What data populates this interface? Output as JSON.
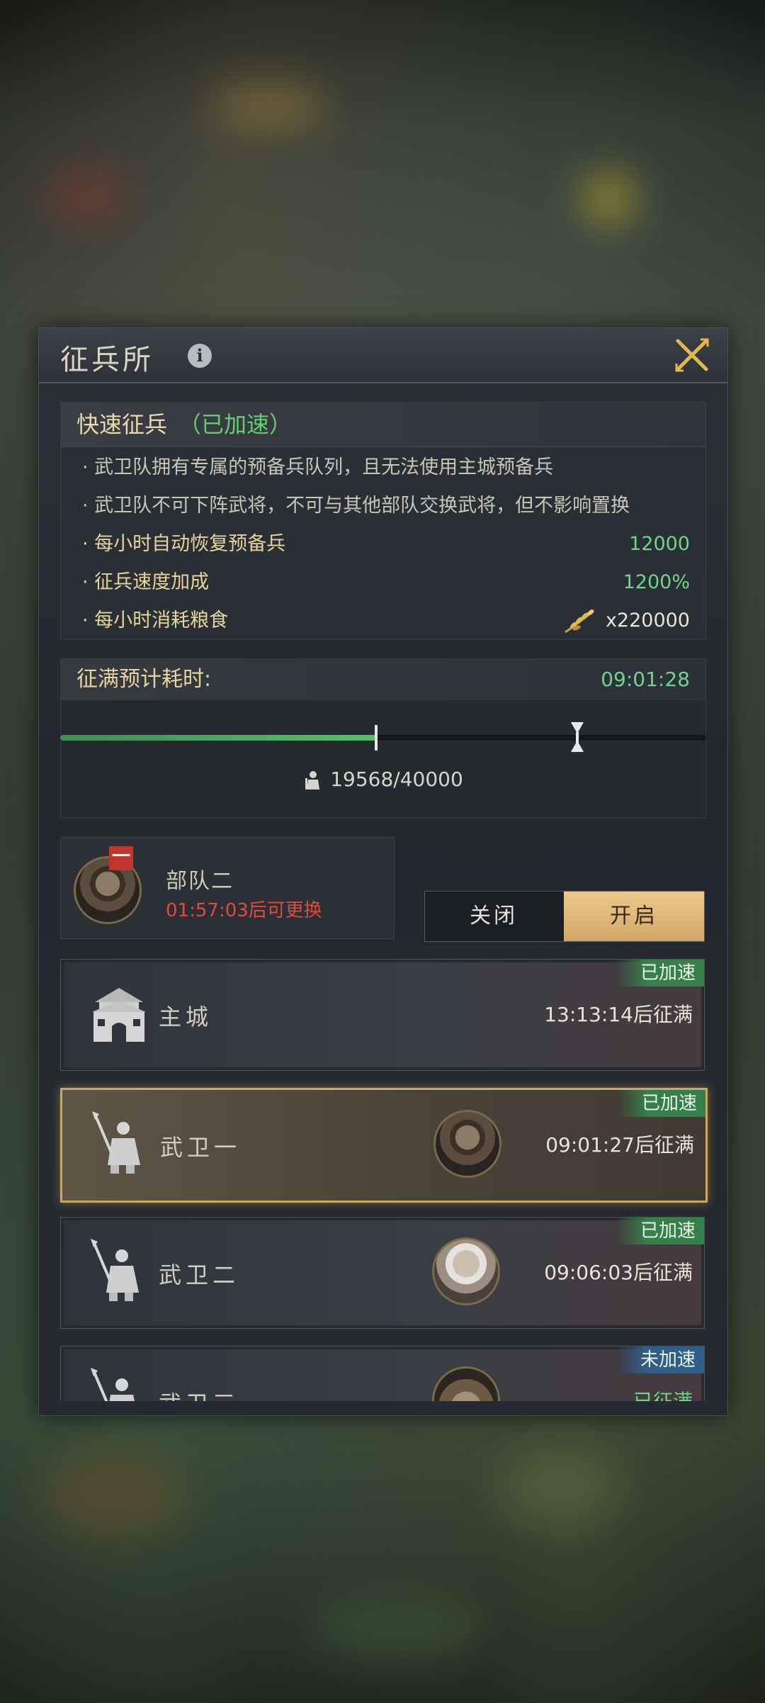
{
  "panel": {
    "title": "征兵所",
    "info_glyph": "i"
  },
  "fast_recruit": {
    "title": "快速征兵",
    "status": "（已加速）",
    "notes": [
      "· 武卫队拥有专属的预备兵队列，且无法使用主城预备兵",
      "· 武卫队不可下阵武将，不可与其他部队交换武将，但不影响置换"
    ],
    "stats": [
      {
        "label": "· 每小时自动恢复预备兵",
        "value": "12000"
      },
      {
        "label": "· 征兵速度加成",
        "value": "1200%"
      },
      {
        "label": "· 每小时消耗粮食",
        "value": "x220000",
        "icon": "grain-icon"
      }
    ]
  },
  "fill_time": {
    "label": "征满预计耗时:",
    "value": "09:01:28",
    "progress": 0.4892,
    "marker_fraction": 0.8,
    "troops": "19568/40000",
    "troops_icon": "soldier-icon"
  },
  "army": {
    "badge": "一",
    "name": "部队二",
    "timer": "01:57:03后可更换"
  },
  "toggle": {
    "off_label": "关闭",
    "on_label": "开启",
    "selected": "开启"
  },
  "list": [
    {
      "name": "主城",
      "time": "13:13:14后征满",
      "tag": "已加速",
      "tag_color": "#35804a",
      "icon": "castle-icon",
      "selected": false
    },
    {
      "name": "武卫一",
      "time": "09:01:27后征满",
      "tag": "已加速",
      "tag_color": "#35804a",
      "icon": "spearman-icon",
      "selected": true
    },
    {
      "name": "武卫二",
      "time": "09:06:03后征满",
      "tag": "已加速",
      "tag_color": "#35804a",
      "icon": "spearman-icon",
      "selected": false
    },
    {
      "name": "武卫三",
      "time": "已征满",
      "tag": "未加速",
      "tag_color": "#2f5f88",
      "icon": "spearman-icon",
      "selected": false
    }
  ],
  "colors": {
    "accent_green": "#6ed58a",
    "accent_gold": "#e6d49c",
    "warning_red": "#e24a3c",
    "selected_border": "#c9a75d"
  }
}
